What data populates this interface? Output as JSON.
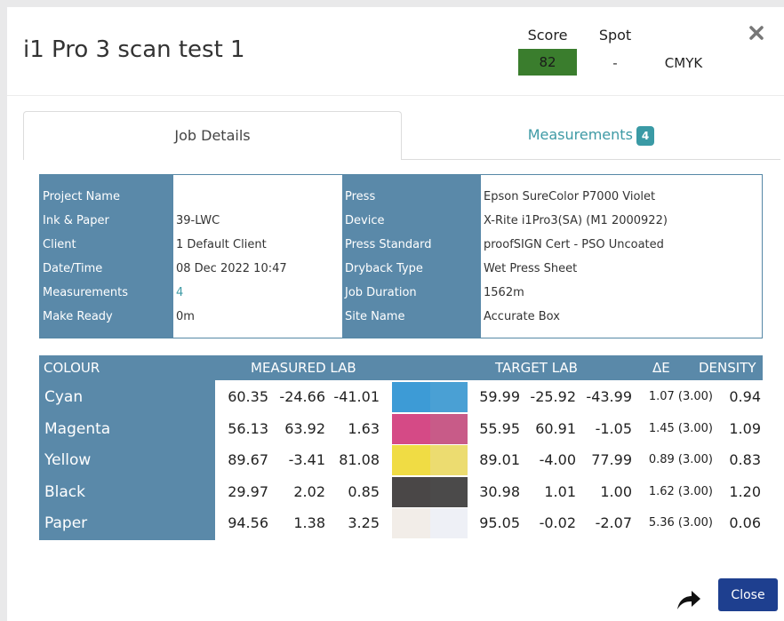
{
  "dialog": {
    "title": "i1 Pro 3 scan test 1",
    "score_label": "Score",
    "score_value": "82",
    "spot_label": "Spot",
    "spot_value": "-",
    "colour_mode": "CMYK"
  },
  "tabs": {
    "job_details": "Job Details",
    "measurements": "Measurements",
    "measurements_count": "4"
  },
  "job_info": {
    "left": [
      {
        "label": "Project Name",
        "value": ""
      },
      {
        "label": "Ink & Paper",
        "value": "39-LWC"
      },
      {
        "label": "Client",
        "value": "1 Default Client"
      },
      {
        "label": "Date/Time",
        "value": "08 Dec 2022 10:47"
      },
      {
        "label": "Measurements",
        "value": "4"
      },
      {
        "label": "Make Ready",
        "value": "0m"
      }
    ],
    "right": [
      {
        "label": "Press",
        "value": "Epson SureColor P7000 Violet"
      },
      {
        "label": "Device",
        "value": "X-Rite i1Pro3(SA) (M1 2000922)"
      },
      {
        "label": "Press Standard",
        "value": "proofSIGN Cert - PSO Uncoated"
      },
      {
        "label": "Dryback Type",
        "value": "Wet Press Sheet"
      },
      {
        "label": "Job Duration",
        "value": "1562m"
      },
      {
        "label": "Site Name",
        "value": "Accurate Box"
      }
    ]
  },
  "colour_table": {
    "headers": {
      "colour": "COLOUR",
      "measured": "MEASURED LAB",
      "target": "TARGET LAB",
      "delta": "ΔE",
      "density": "DENSITY"
    },
    "rows": [
      {
        "name": "Cyan",
        "m_l": "60.35",
        "m_a": "-24.66",
        "m_b": "-41.01",
        "t_l": "59.99",
        "t_a": "-25.92",
        "t_b": "-43.99",
        "de": "1.07 (3.00)",
        "density": "0.94",
        "measured_color": "#3d9bd6",
        "target_color": "#4aa0d4"
      },
      {
        "name": "Magenta",
        "m_l": "56.13",
        "m_a": "63.92",
        "m_b": "1.63",
        "t_l": "55.95",
        "t_a": "60.91",
        "t_b": "-1.05",
        "de": "1.45 (3.00)",
        "density": "1.09",
        "measured_color": "#d54a86",
        "target_color": "#c85b88"
      },
      {
        "name": "Yellow",
        "m_l": "89.67",
        "m_a": "-3.41",
        "m_b": "81.08",
        "t_l": "89.01",
        "t_a": "-4.00",
        "t_b": "77.99",
        "de": "0.89 (3.00)",
        "density": "0.83",
        "measured_color": "#f0dc44",
        "target_color": "#ecdc70"
      },
      {
        "name": "Black",
        "m_l": "29.97",
        "m_a": "2.02",
        "m_b": "0.85",
        "t_l": "30.98",
        "t_a": "1.01",
        "t_b": "1.00",
        "de": "1.62 (3.00)",
        "density": "1.20",
        "measured_color": "#4a4747",
        "target_color": "#4b4a4a"
      },
      {
        "name": "Paper",
        "m_l": "94.56",
        "m_a": "1.38",
        "m_b": "3.25",
        "t_l": "95.05",
        "t_a": "-0.02",
        "t_b": "-2.07",
        "de": "5.36 (3.00)",
        "density": "0.06",
        "measured_color": "#f2ede8",
        "target_color": "#eef0f6"
      }
    ]
  },
  "footer": {
    "close_label": "Close"
  }
}
